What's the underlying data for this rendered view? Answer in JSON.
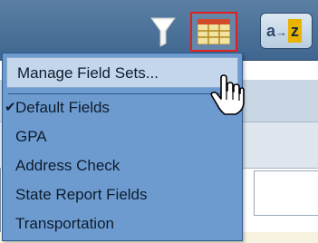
{
  "toolbar": {
    "icons": [
      "filter-icon",
      "field-set-grid-icon",
      "sort-az-icon"
    ],
    "sort_label_a": "a",
    "sort_label_arrow": "→",
    "sort_label_z": "z",
    "highlight_color": "#e02020"
  },
  "menu": {
    "manage_label": "Manage Field Sets...",
    "items": [
      {
        "label": "Default Fields",
        "checked": true
      },
      {
        "label": "GPA",
        "checked": false
      },
      {
        "label": "Address Check",
        "checked": false
      },
      {
        "label": "State Report Fields",
        "checked": false
      },
      {
        "label": "Transportation",
        "checked": false
      }
    ],
    "check_glyph": "✔",
    "background_color": "#6d9bd0"
  }
}
